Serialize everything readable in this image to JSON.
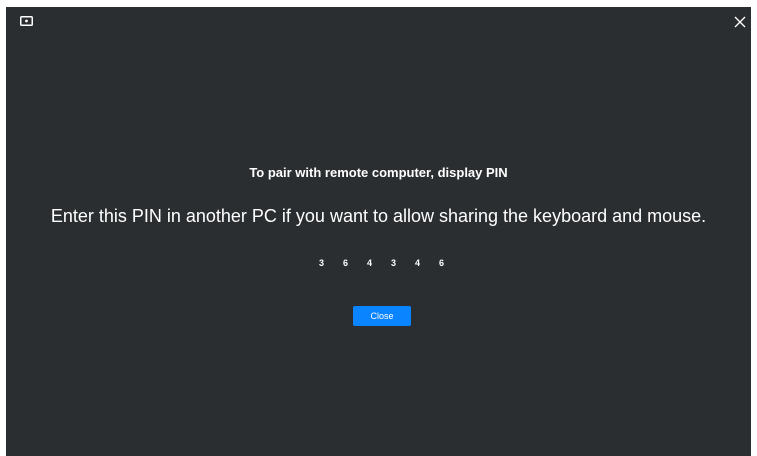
{
  "window": {
    "icon": "display-icon",
    "close_icon": "close-icon"
  },
  "dialog": {
    "heading": "To pair with remote computer, display PIN",
    "message": "Enter this PIN in another PC if you want to allow sharing the keyboard and mouse.",
    "pin_digits": [
      "3",
      "6",
      "4",
      "3",
      "4",
      "6"
    ],
    "close_label": "Close"
  },
  "colors": {
    "background": "#2b2e30",
    "accent": "#0a84ff",
    "text": "#ffffff"
  }
}
